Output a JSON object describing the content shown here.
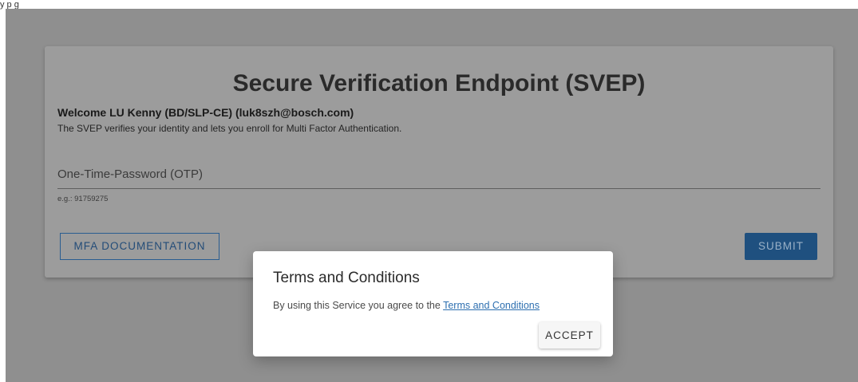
{
  "frame_fragment": "y p g",
  "main": {
    "title": "Secure Verification Endpoint (SVEP)",
    "welcome": "Welcome LU Kenny (BD/SLP-CE) (luk8szh@bosch.com)",
    "description": "The SVEP verifies your identity and lets you enroll for Multi Factor Authentication.",
    "otp": {
      "label": "One-Time-Password (OTP)",
      "hint": "e.g.: 91759275"
    },
    "mfa_doc_label": "MFA DOCUMENTATION",
    "submit_label": "SUBMIT"
  },
  "modal": {
    "title": "Terms and Conditions",
    "body_prefix": "By using this Service you agree to the ",
    "link_label": "Terms and Conditions",
    "accept_label": "ACCEPT"
  },
  "colors": {
    "overlay_bg": "#8f8f8f",
    "card_bg": "#9c9c9c",
    "submit_bg": "#1f507f",
    "link": "#2d6fb0",
    "modal_bg": "#ffffff"
  }
}
